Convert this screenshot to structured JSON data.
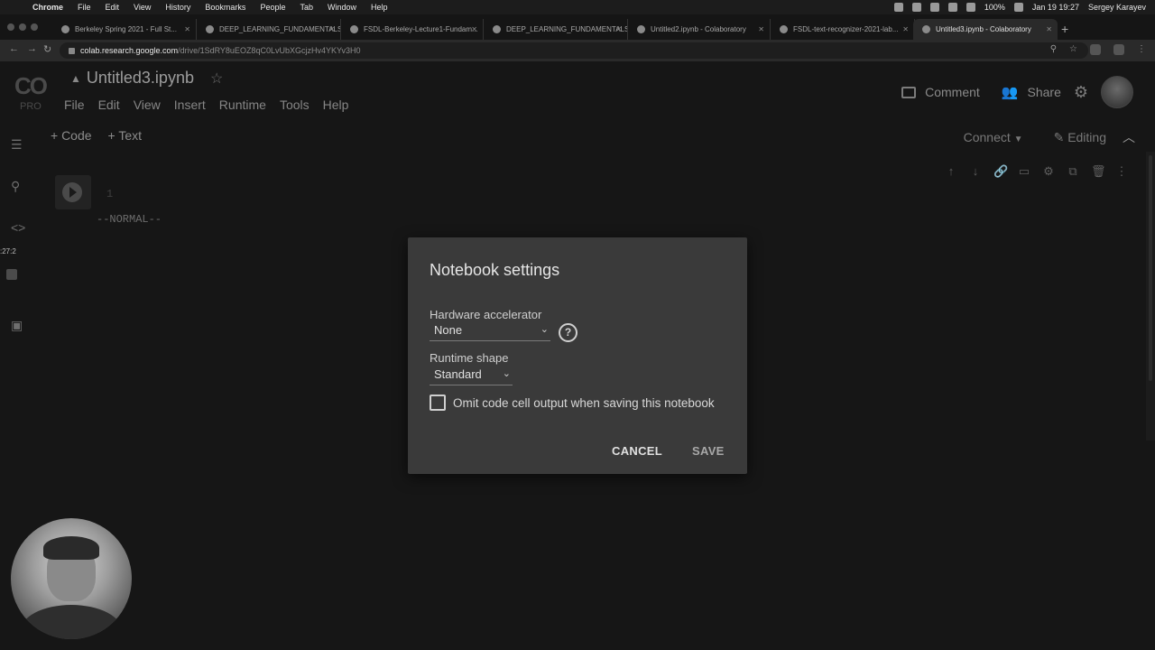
{
  "menubar": {
    "app_name": "Chrome",
    "items": [
      "File",
      "Edit",
      "View",
      "History",
      "Bookmarks",
      "People",
      "Tab",
      "Window",
      "Help"
    ],
    "battery": "100%",
    "datetime": "Jan 19  19:27",
    "user": "Sergey Karayev"
  },
  "tabs": [
    {
      "label": "Berkeley Spring 2021 - Full St..."
    },
    {
      "label": "DEEP_LEARNING_FUNDAMENTALS_..."
    },
    {
      "label": "FSDL-Berkeley-Lecture1-Fundam..."
    },
    {
      "label": "DEEP_LEARNING_FUNDAMENTALS_..."
    },
    {
      "label": "Untitled2.ipynb - Colaboratory"
    },
    {
      "label": "FSDL-text-recognizer-2021-lab..."
    },
    {
      "label": "Untitled3.ipynb - Colaboratory"
    }
  ],
  "address": {
    "host": "colab.research.google.com",
    "path": "/drive/1SdRY8uEOZ8qC0LvUbXGcjzHv4YKYv3H0"
  },
  "colab": {
    "logo": "CO",
    "plan": "PRO",
    "title": "Untitled3.ipynb",
    "menus": [
      "File",
      "Edit",
      "View",
      "Insert",
      "Runtime",
      "Tools",
      "Help"
    ],
    "comment_label": "Comment",
    "share_label": "Share",
    "add_code": "+ Code",
    "add_text": "+ Text",
    "connect_label": "Connect",
    "editing_label": "Editing",
    "timer": ":27:2",
    "cell": {
      "line_number": "1",
      "vim_mode": "--NORMAL--"
    }
  },
  "dialog": {
    "title": "Notebook settings",
    "hardware_label": "Hardware accelerator",
    "hardware_value": "None",
    "shape_label": "Runtime shape",
    "shape_value": "Standard",
    "omit_label": "Omit code cell output when saving this notebook",
    "omit_checked": false,
    "cancel": "CANCEL",
    "save": "SAVE"
  }
}
